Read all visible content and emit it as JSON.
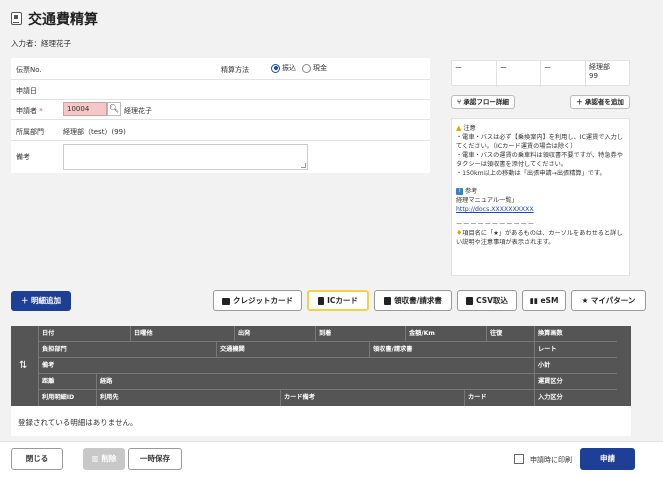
{
  "page": {
    "title": "交通費精算",
    "inputter": "入力者：経理花子"
  },
  "form": {
    "slip_no_label": "伝票No.",
    "slip_no_value": "",
    "settlement_label": "精算方法",
    "settlement_options": [
      "振込",
      "現金"
    ],
    "settlement_selected": "振込",
    "apply_date_label": "申請日",
    "applicant_label": "申請者",
    "applicant_required_mark": "*",
    "applicant_code": "10004",
    "applicant_name": "経理花子",
    "department_label": "所属部門",
    "department_value": "経理部（test）(99)",
    "remarks_label": "備考",
    "remarks_value": ""
  },
  "approval": {
    "cells": [
      "ー",
      "ー",
      "ー",
      "経理部\n99"
    ],
    "flow_button": "承認フロー詳細",
    "add_approver_button": "＋ 承認者を追加"
  },
  "notes": {
    "caution_title": "注意",
    "caution_lines": [
      "・電車・バスは必ず【乗換案内】を利用し、IC運賃で入力してください。（ICカード運賃の場合は除く）",
      "・電車・バスの運賃の乗車料は領収書不要ですが、特急券やタクシーは領収書を添付してください。",
      "・150km以上の移動は「出張申請→出張精算」です。"
    ],
    "reference_title": "参考",
    "reference_text": "経理マニュアル一覧」",
    "reference_link": "http://docs.XXXXXXXXXX",
    "divider": "ーーーーーーーーーーー",
    "tip_text": "項目名に「★」があるものは、カーソルをあわせると詳しい説明や注意事項が表示されます。"
  },
  "toolbar": {
    "add_line": "＋ 明細追加",
    "credit_card": "クレジットカード",
    "ic_card": "ICカード",
    "receipt": "領収書/請求書",
    "csv_import": "CSV取込",
    "esm": "eSM",
    "my_pattern": "マイパターン"
  },
  "grid": {
    "row1": [
      "日付",
      "日曜他",
      "出発",
      "到着",
      "金額/Km",
      "往復",
      "換算画数"
    ],
    "row2": [
      "負担部門",
      "交通機関",
      "領収書/請求書",
      "レート"
    ],
    "row3": [
      "備考",
      "小計"
    ],
    "row4": [
      "距離",
      "経路",
      "運賃区分"
    ],
    "row5": [
      "利用明細ID",
      "利用先",
      "カード備考",
      "カード",
      "入力区分"
    ],
    "empty_message": "登録されている明細はありません。"
  },
  "footer": {
    "close": "閉じる",
    "delete": "削除",
    "temp_save": "一時保存",
    "print_on_apply": "申請時に印刷",
    "apply": "申請"
  }
}
